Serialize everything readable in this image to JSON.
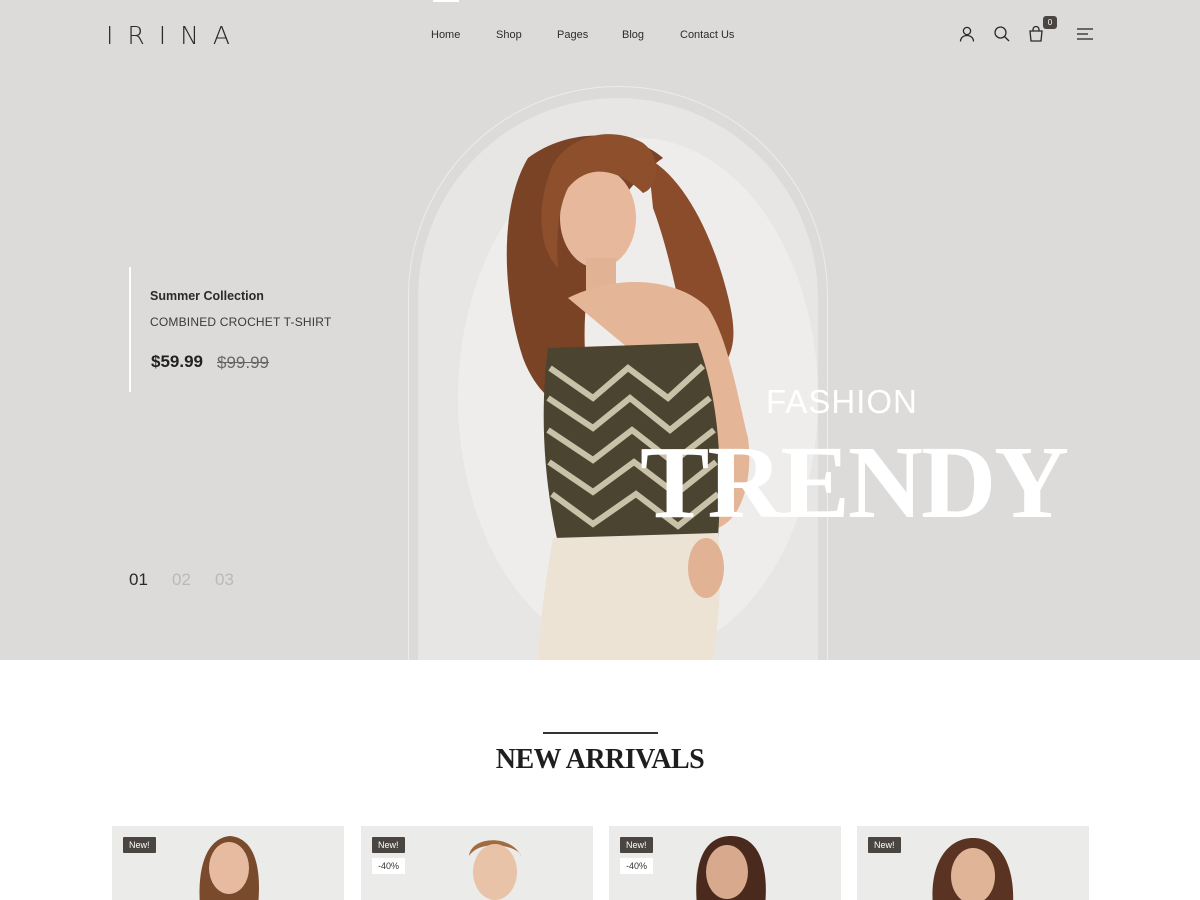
{
  "header": {
    "logo": "IRINA",
    "nav": [
      {
        "label": "Home"
      },
      {
        "label": "Shop"
      },
      {
        "label": "Pages"
      },
      {
        "label": "Blog"
      },
      {
        "label": "Contact Us"
      }
    ],
    "icons": [
      "user-icon",
      "search-icon",
      "cart-icon",
      "menu-icon"
    ],
    "cart_count": "0"
  },
  "hero": {
    "collection": "Summer Collection",
    "product_name": "COMBINED CROCHET T-SHIRT",
    "price": "$59.99",
    "old_price": "$99.99",
    "headline_small": "FASHION",
    "headline_large": "TRENDY",
    "slides": [
      "01",
      "02",
      "03"
    ],
    "active_slide": "01"
  },
  "arrivals": {
    "title": "NEW ARRIVALS",
    "products": [
      {
        "badge": "New!",
        "sale": ""
      },
      {
        "badge": "New!",
        "sale": "-40%"
      },
      {
        "badge": "New!",
        "sale": "-40%"
      },
      {
        "badge": "New!",
        "sale": ""
      }
    ]
  },
  "colors": {
    "hero_bg": "#dcdbd9",
    "badge_bg": "#4a4540",
    "text_dark": "#222222"
  }
}
